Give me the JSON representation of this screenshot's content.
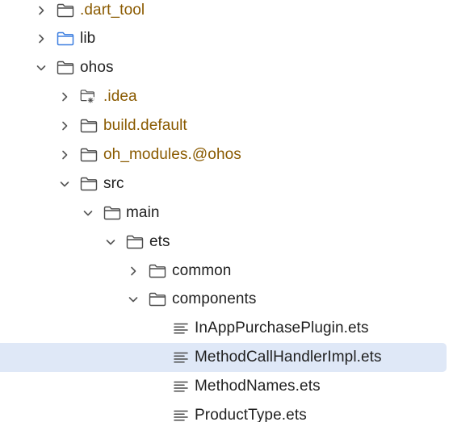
{
  "colors": {
    "default_text": "#1f1f1f",
    "excluded_text": "#8a5a00",
    "source_root_folder": "#3d7fe0",
    "selection": "#dfe8f7",
    "icon_stroke": "#4a4a4a"
  },
  "tree": {
    "items": [
      {
        "label": ".dart_tool",
        "icon": "folder-icon",
        "state": "collapsed",
        "style": "excluded"
      },
      {
        "label": "lib",
        "icon": "source-folder-icon",
        "state": "collapsed",
        "style": "default"
      },
      {
        "label": "ohos",
        "icon": "folder-icon",
        "state": "expanded",
        "style": "default"
      },
      {
        "label": ".idea",
        "icon": "config-folder-icon",
        "state": "collapsed",
        "style": "excluded"
      },
      {
        "label": "build.default",
        "icon": "folder-icon",
        "state": "collapsed",
        "style": "excluded"
      },
      {
        "label": "oh_modules.@ohos",
        "icon": "folder-icon",
        "state": "collapsed",
        "style": "excluded"
      },
      {
        "label": "src",
        "icon": "folder-icon",
        "state": "expanded",
        "style": "default"
      },
      {
        "label": "main",
        "icon": "folder-icon",
        "state": "expanded",
        "style": "default"
      },
      {
        "label": "ets",
        "icon": "folder-icon",
        "state": "expanded",
        "style": "default"
      },
      {
        "label": "common",
        "icon": "folder-icon",
        "state": "collapsed",
        "style": "default"
      },
      {
        "label": "components",
        "icon": "folder-icon",
        "state": "expanded",
        "style": "default"
      },
      {
        "label": "InAppPurchasePlugin.ets",
        "icon": "text-file-icon",
        "state": "leaf",
        "style": "default"
      },
      {
        "label": "MethodCallHandlerImpl.ets",
        "icon": "text-file-icon",
        "state": "leaf",
        "style": "default",
        "selected": true
      },
      {
        "label": "MethodNames.ets",
        "icon": "text-file-icon",
        "state": "leaf",
        "style": "default"
      },
      {
        "label": "ProductType.ets",
        "icon": "text-file-icon",
        "state": "leaf",
        "style": "default"
      }
    ]
  }
}
